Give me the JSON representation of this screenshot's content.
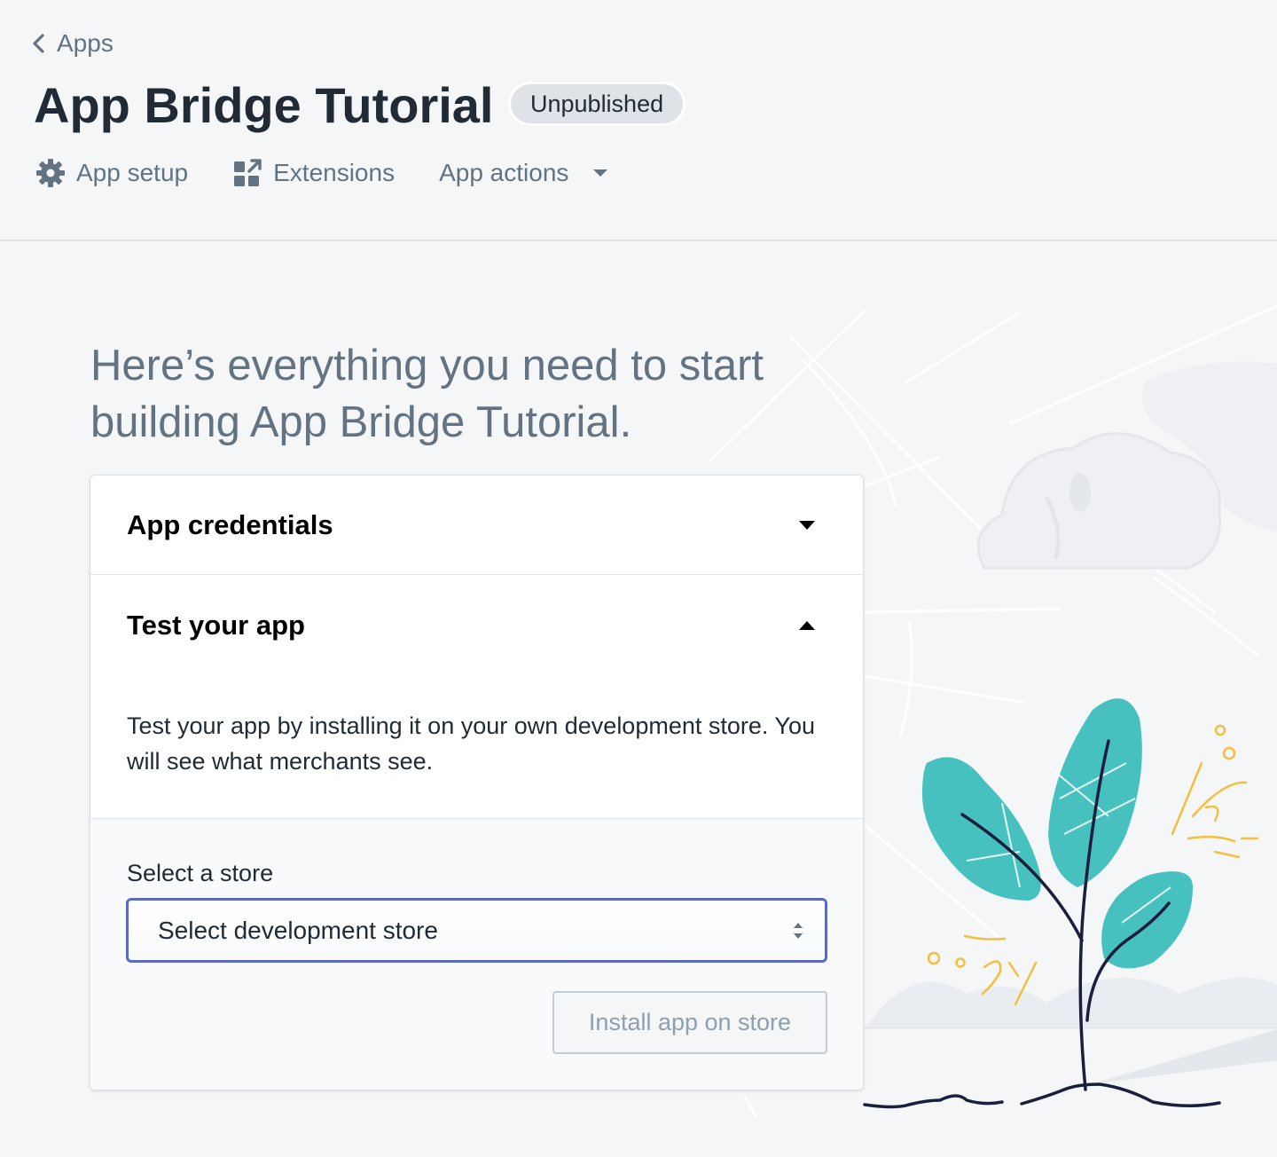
{
  "breadcrumb": {
    "label": "Apps"
  },
  "header": {
    "title": "App Bridge Tutorial",
    "status_badge": "Unpublished"
  },
  "tabs": [
    {
      "label": "App setup",
      "icon": "gear-icon"
    },
    {
      "label": "Extensions",
      "icon": "extensions-icon"
    },
    {
      "label": "App actions",
      "icon": "caret-down-icon"
    }
  ],
  "main": {
    "headline": "Here’s everything you need to start building App Bridge Tutorial.",
    "sections": [
      {
        "label": "App credentials",
        "state": "collapsed"
      },
      {
        "label": "Test your app",
        "state": "expanded"
      }
    ],
    "test_description": "Test your app by installing it on your own development store. You will see what merchants see.",
    "select_label": "Select a store",
    "select_value": "Select development store",
    "install_button": "Install app on store"
  },
  "colors": {
    "accent": "#5c6ac4",
    "leaf": "#47c1bf",
    "sparkle": "#f4bf3e",
    "text_muted": "#637381"
  }
}
